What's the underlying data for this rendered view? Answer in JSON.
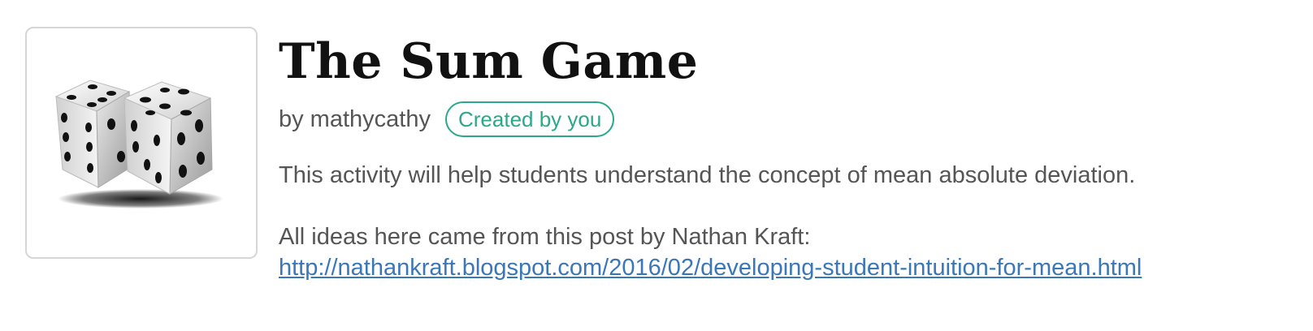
{
  "activity": {
    "title": "The Sum Game",
    "author": "by mathycathy",
    "badge": "Created by you",
    "description": "This activity will help students understand the concept of mean absolute deviation.",
    "ideas_text": "All ideas here came from this post by Nathan Kraft:",
    "link": "http://nathankraft.blogspot.com/2016/02/developing-student-intuition-for-mean.html",
    "thumbnail_icon": "dice-icon"
  },
  "colors": {
    "badge": "#2aa889",
    "link": "#3a77b8",
    "body_text": "#555555",
    "title_text": "#111111"
  }
}
